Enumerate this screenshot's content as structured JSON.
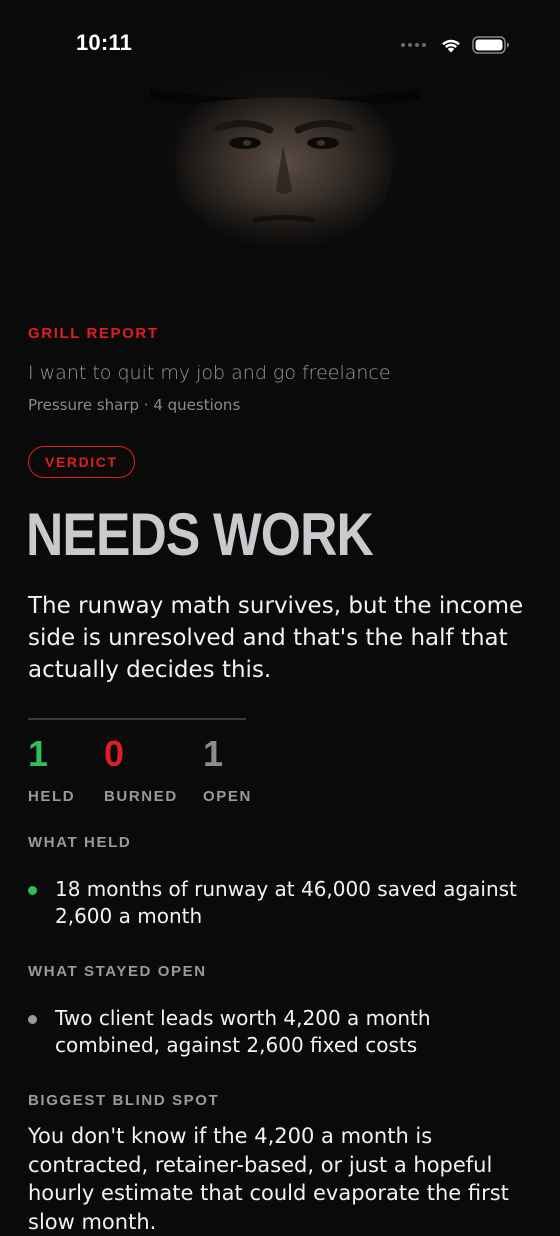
{
  "status_bar": {
    "time": "10:11",
    "icons": [
      "signal-dots-icon",
      "wifi-icon",
      "battery-icon"
    ]
  },
  "hero": {
    "image": "stern-face-portrait"
  },
  "report": {
    "eyebrow": "GRILL REPORT",
    "topic": "I want to quit my job and go freelance",
    "meta": "Pressure sharp · 4 questions"
  },
  "verdict": {
    "pill_label": "VERDICT",
    "title": "NEEDS WORK",
    "summary": "The runway math survives, but the income side is unresolved and that's the half that actually decides this."
  },
  "stats": [
    {
      "value": "1",
      "label": "HELD",
      "color": "#2fbf5a"
    },
    {
      "value": "0",
      "label": "BURNED",
      "color": "#e11d24"
    },
    {
      "value": "1",
      "label": "OPEN",
      "color": "#8c8c8c"
    }
  ],
  "sections": {
    "what_held": {
      "label": "WHAT HELD",
      "items": [
        "18 months of runway at 46,000 saved against 2,600 a month"
      ],
      "dot_color": "#2fbf5a"
    },
    "what_stayed_open": {
      "label": "WHAT STAYED OPEN",
      "items": [
        "Two client leads worth 4,200 a month combined, against 2,600 fixed costs"
      ],
      "dot_color": "#9a9a9a"
    },
    "biggest_blind_spot": {
      "label": "BIGGEST BLIND SPOT",
      "text": "You don't know if the 4,200 a month is contracted, retainer-based, or just a hopeful hourly estimate that could evaporate the first slow month."
    }
  },
  "colors": {
    "accent": "#e11d24",
    "held": "#2fbf5a",
    "background": "#0a0a0a"
  }
}
